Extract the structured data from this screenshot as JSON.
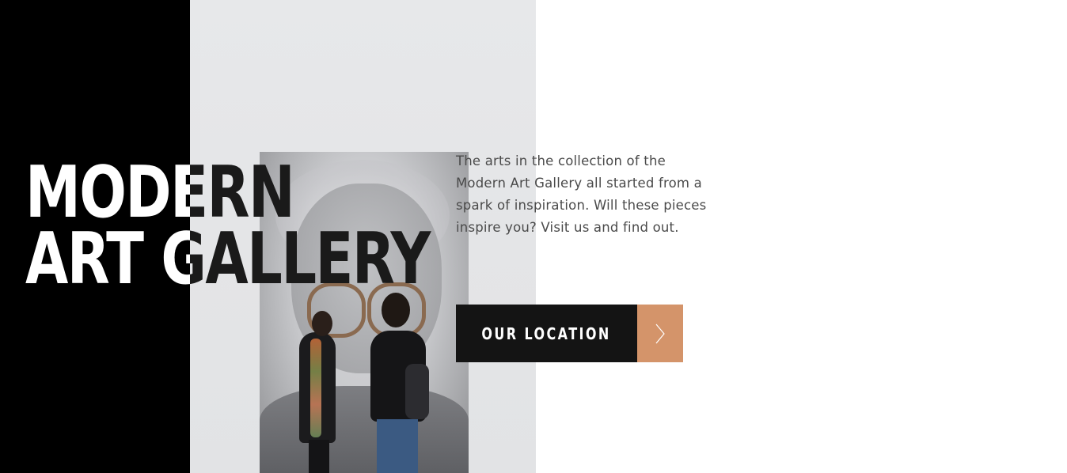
{
  "hero": {
    "title_line1": "MODERN",
    "title_line2": "ART GALLERY",
    "description": "The arts in the collection of the Modern Art Gallery all started from a spark of inspiration. Will these pieces inspire you? Visit us and find out.",
    "cta_label": "OUR LOCATION",
    "cta_icon": "chevron-right-icon"
  },
  "colors": {
    "background": "#ffffff",
    "dark_panel": "#000000",
    "button_dark": "#141414",
    "accent": "#d4946a",
    "text": "#4a4a4a"
  }
}
